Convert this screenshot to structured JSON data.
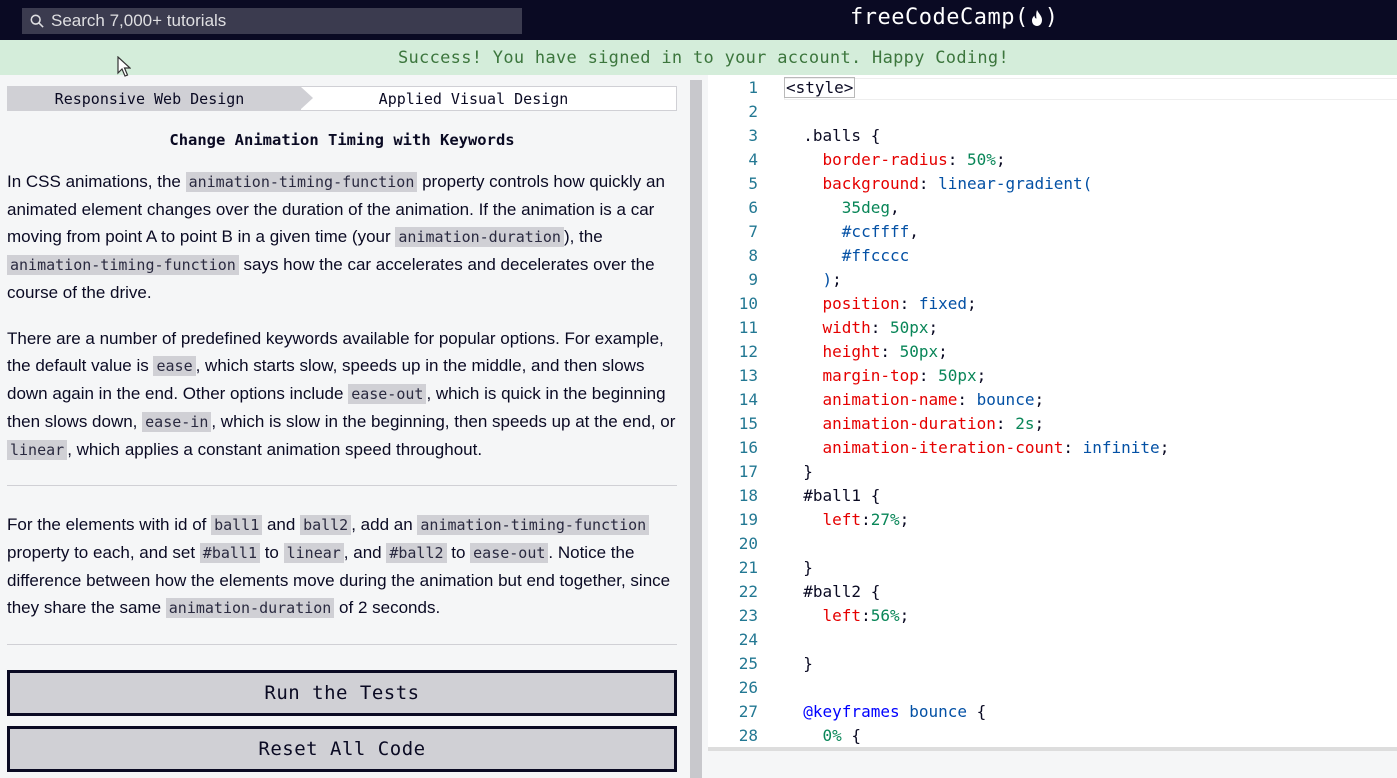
{
  "nav": {
    "search_placeholder": "Search 7,000+ tutorials",
    "logo_left": "freeCodeCamp(",
    "logo_right": ")"
  },
  "flash": {
    "message": "Success! You have signed in to your account. Happy Coding!"
  },
  "breadcrumb": {
    "superblock": "Responsive Web Design",
    "block": "Applied Visual Design"
  },
  "challenge": {
    "title": "Change Animation Timing with Keywords",
    "p1": [
      {
        "t": "In CSS animations, the "
      },
      {
        "c": "animation-timing-function"
      },
      {
        "t": " property controls how quickly an animated element changes over the duration of the animation. If the animation is a car moving from point A to point B in a given time (your "
      },
      {
        "c": "animation-duration"
      },
      {
        "t": "), the "
      },
      {
        "c": "animation-timing-function"
      },
      {
        "t": " says how the car accelerates and decelerates over the course of the drive."
      }
    ],
    "p2": [
      {
        "t": "There are a number of predefined keywords available for popular options. For example, the default value is "
      },
      {
        "c": "ease"
      },
      {
        "t": ", which starts slow, speeds up in the middle, and then slows down again in the end. Other options include "
      },
      {
        "c": "ease-out"
      },
      {
        "t": ", which is quick in the beginning then slows down, "
      },
      {
        "c": "ease-in"
      },
      {
        "t": ", which is slow in the beginning, then speeds up at the end, or "
      },
      {
        "c": "linear"
      },
      {
        "t": ", which applies a constant animation speed throughout."
      }
    ],
    "instructions": [
      {
        "t": "For the elements with id of "
      },
      {
        "c": "ball1"
      },
      {
        "t": " and "
      },
      {
        "c": "ball2"
      },
      {
        "t": ", add an "
      },
      {
        "c": "animation-timing-function"
      },
      {
        "t": " property to each, and set "
      },
      {
        "c": "#ball1"
      },
      {
        "t": " to "
      },
      {
        "c": "linear"
      },
      {
        "t": ", and "
      },
      {
        "c": "#ball2"
      },
      {
        "t": " to "
      },
      {
        "c": "ease-out"
      },
      {
        "t": ". Notice the difference between how the elements move during the animation but end together, since they share the same "
      },
      {
        "c": "animation-duration"
      },
      {
        "t": " of 2 seconds."
      }
    ]
  },
  "buttons": {
    "run": "Run the Tests",
    "reset": "Reset All Code"
  },
  "editor": {
    "lines": [
      {
        "n": "1",
        "indent": "",
        "tokens": [
          [
            "tag-box",
            "<style>"
          ]
        ]
      },
      {
        "n": "2",
        "indent": "",
        "tokens": []
      },
      {
        "n": "3",
        "indent": "  ",
        "tokens": [
          [
            "t-punc",
            ".balls {"
          ]
        ]
      },
      {
        "n": "4",
        "indent": "    ",
        "tokens": [
          [
            "t-prop",
            "border-radius"
          ],
          [
            "t-punc",
            ": "
          ],
          [
            "t-num",
            "50%"
          ],
          [
            "t-punc",
            ";"
          ]
        ]
      },
      {
        "n": "5",
        "indent": "    ",
        "tokens": [
          [
            "t-prop",
            "background"
          ],
          [
            "t-punc",
            ": "
          ],
          [
            "t-val",
            "linear-gradient("
          ]
        ]
      },
      {
        "n": "6",
        "indent": "      ",
        "tokens": [
          [
            "t-num",
            "35deg"
          ],
          [
            "t-punc",
            ","
          ]
        ]
      },
      {
        "n": "7",
        "indent": "      ",
        "tokens": [
          [
            "t-val",
            "#ccffff"
          ],
          [
            "t-punc",
            ","
          ]
        ]
      },
      {
        "n": "8",
        "indent": "      ",
        "tokens": [
          [
            "t-val",
            "#ffcccc"
          ]
        ]
      },
      {
        "n": "9",
        "indent": "    ",
        "tokens": [
          [
            "t-val",
            ")"
          ],
          [
            "t-punc",
            ";"
          ]
        ]
      },
      {
        "n": "10",
        "indent": "    ",
        "tokens": [
          [
            "t-prop",
            "position"
          ],
          [
            "t-punc",
            ": "
          ],
          [
            "t-val",
            "fixed"
          ],
          [
            "t-punc",
            ";"
          ]
        ]
      },
      {
        "n": "11",
        "indent": "    ",
        "tokens": [
          [
            "t-prop",
            "width"
          ],
          [
            "t-punc",
            ": "
          ],
          [
            "t-num",
            "50px"
          ],
          [
            "t-punc",
            ";"
          ]
        ]
      },
      {
        "n": "12",
        "indent": "    ",
        "tokens": [
          [
            "t-prop",
            "height"
          ],
          [
            "t-punc",
            ": "
          ],
          [
            "t-num",
            "50px"
          ],
          [
            "t-punc",
            ";"
          ]
        ]
      },
      {
        "n": "13",
        "indent": "    ",
        "tokens": [
          [
            "t-prop",
            "margin-top"
          ],
          [
            "t-punc",
            ": "
          ],
          [
            "t-num",
            "50px"
          ],
          [
            "t-punc",
            ";"
          ]
        ]
      },
      {
        "n": "14",
        "indent": "    ",
        "tokens": [
          [
            "t-prop",
            "animation-name"
          ],
          [
            "t-punc",
            ": "
          ],
          [
            "t-val",
            "bounce"
          ],
          [
            "t-punc",
            ";"
          ]
        ]
      },
      {
        "n": "15",
        "indent": "    ",
        "tokens": [
          [
            "t-prop",
            "animation-duration"
          ],
          [
            "t-punc",
            ": "
          ],
          [
            "t-num",
            "2s"
          ],
          [
            "t-punc",
            ";"
          ]
        ]
      },
      {
        "n": "16",
        "indent": "    ",
        "tokens": [
          [
            "t-prop",
            "animation-iteration-count"
          ],
          [
            "t-punc",
            ": "
          ],
          [
            "t-val",
            "infinite"
          ],
          [
            "t-punc",
            ";"
          ]
        ]
      },
      {
        "n": "17",
        "indent": "  ",
        "tokens": [
          [
            "t-punc",
            "}"
          ]
        ]
      },
      {
        "n": "18",
        "indent": "  ",
        "tokens": [
          [
            "t-punc",
            "#ball1 {"
          ]
        ]
      },
      {
        "n": "19",
        "indent": "    ",
        "tokens": [
          [
            "t-prop",
            "left"
          ],
          [
            "t-punc",
            ":"
          ],
          [
            "t-num",
            "27%"
          ],
          [
            "t-punc",
            ";"
          ]
        ]
      },
      {
        "n": "20",
        "indent": "",
        "tokens": []
      },
      {
        "n": "21",
        "indent": "  ",
        "tokens": [
          [
            "t-punc",
            "}"
          ]
        ]
      },
      {
        "n": "22",
        "indent": "  ",
        "tokens": [
          [
            "t-punc",
            "#ball2 {"
          ]
        ]
      },
      {
        "n": "23",
        "indent": "    ",
        "tokens": [
          [
            "t-prop",
            "left"
          ],
          [
            "t-punc",
            ":"
          ],
          [
            "t-num",
            "56%"
          ],
          [
            "t-punc",
            ";"
          ]
        ]
      },
      {
        "n": "24",
        "indent": "",
        "tokens": []
      },
      {
        "n": "25",
        "indent": "  ",
        "tokens": [
          [
            "t-punc",
            "}"
          ]
        ]
      },
      {
        "n": "26",
        "indent": "",
        "tokens": []
      },
      {
        "n": "27",
        "indent": "  ",
        "tokens": [
          [
            "t-kw",
            "@keyframes"
          ],
          [
            "t-punc",
            " "
          ],
          [
            "t-val",
            "bounce"
          ],
          [
            "t-punc",
            " {"
          ]
        ]
      },
      {
        "n": "28",
        "indent": "    ",
        "tokens": [
          [
            "t-num",
            "0%"
          ],
          [
            "t-punc",
            " {"
          ]
        ]
      }
    ]
  },
  "colors": {
    "nav_bg": "#0a0a23",
    "flash_bg": "#d4edda",
    "flash_text": "#3c763d",
    "code_bg": "#d0d0d5"
  },
  "icons": {
    "search": "magnifier-icon",
    "logo": "flame-icon",
    "cursor": "mouse-pointer-icon"
  }
}
